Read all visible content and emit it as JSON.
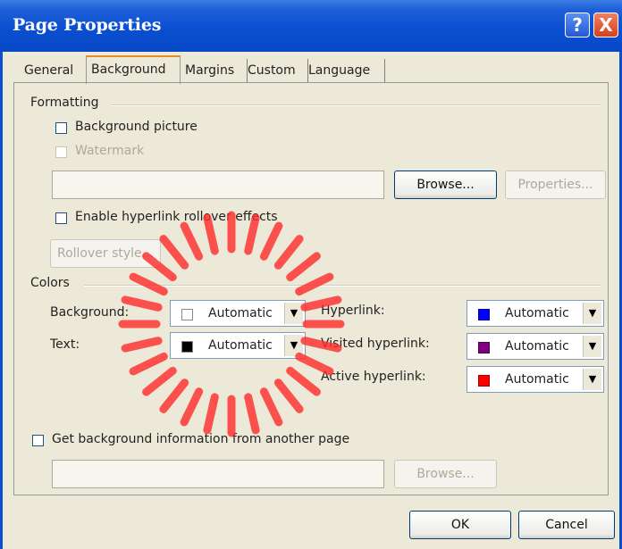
{
  "window": {
    "title": "Page Properties",
    "help_glyph": "?",
    "close_glyph": "X"
  },
  "tabs": [
    {
      "label": "General"
    },
    {
      "label": "Background",
      "active": true
    },
    {
      "label": "Margins"
    },
    {
      "label": "Custom"
    },
    {
      "label": "Language"
    }
  ],
  "formatting": {
    "group_label": "Formatting",
    "background_picture": {
      "label": "Background picture",
      "checked": false
    },
    "watermark": {
      "label": "Watermark",
      "checked": false,
      "enabled": false
    },
    "picture_path": "",
    "browse_label": "Browse...",
    "properties_label": "Properties...",
    "rollover": {
      "label": "Enable hyperlink rollover effects",
      "checked": false
    },
    "rollover_style_label": "Rollover style..."
  },
  "colors": {
    "group_label": "Colors",
    "background": {
      "label": "Background:",
      "value": "Automatic",
      "swatch": "#ffffff"
    },
    "text": {
      "label": "Text:",
      "value": "Automatic",
      "swatch": "#000000"
    },
    "hyperlink": {
      "label": "Hyperlink:",
      "value": "Automatic",
      "swatch": "#0000ff"
    },
    "visited_hyperlink": {
      "label": "Visited hyperlink:",
      "value": "Automatic",
      "swatch": "#800080"
    },
    "active_hyperlink": {
      "label": "Active hyperlink:",
      "value": "Automatic",
      "swatch": "#ff0000"
    }
  },
  "get_background": {
    "label": "Get background information from another page",
    "checked": false,
    "path": "",
    "browse_label": "Browse..."
  },
  "footer": {
    "ok_label": "OK",
    "cancel_label": "Cancel"
  },
  "theme": {
    "titlebar": "#0a4fd0",
    "dialog_bg": "#ece9d8",
    "highlight_burst": "#ff2a2a",
    "tab_accent": "#e68b2c"
  }
}
